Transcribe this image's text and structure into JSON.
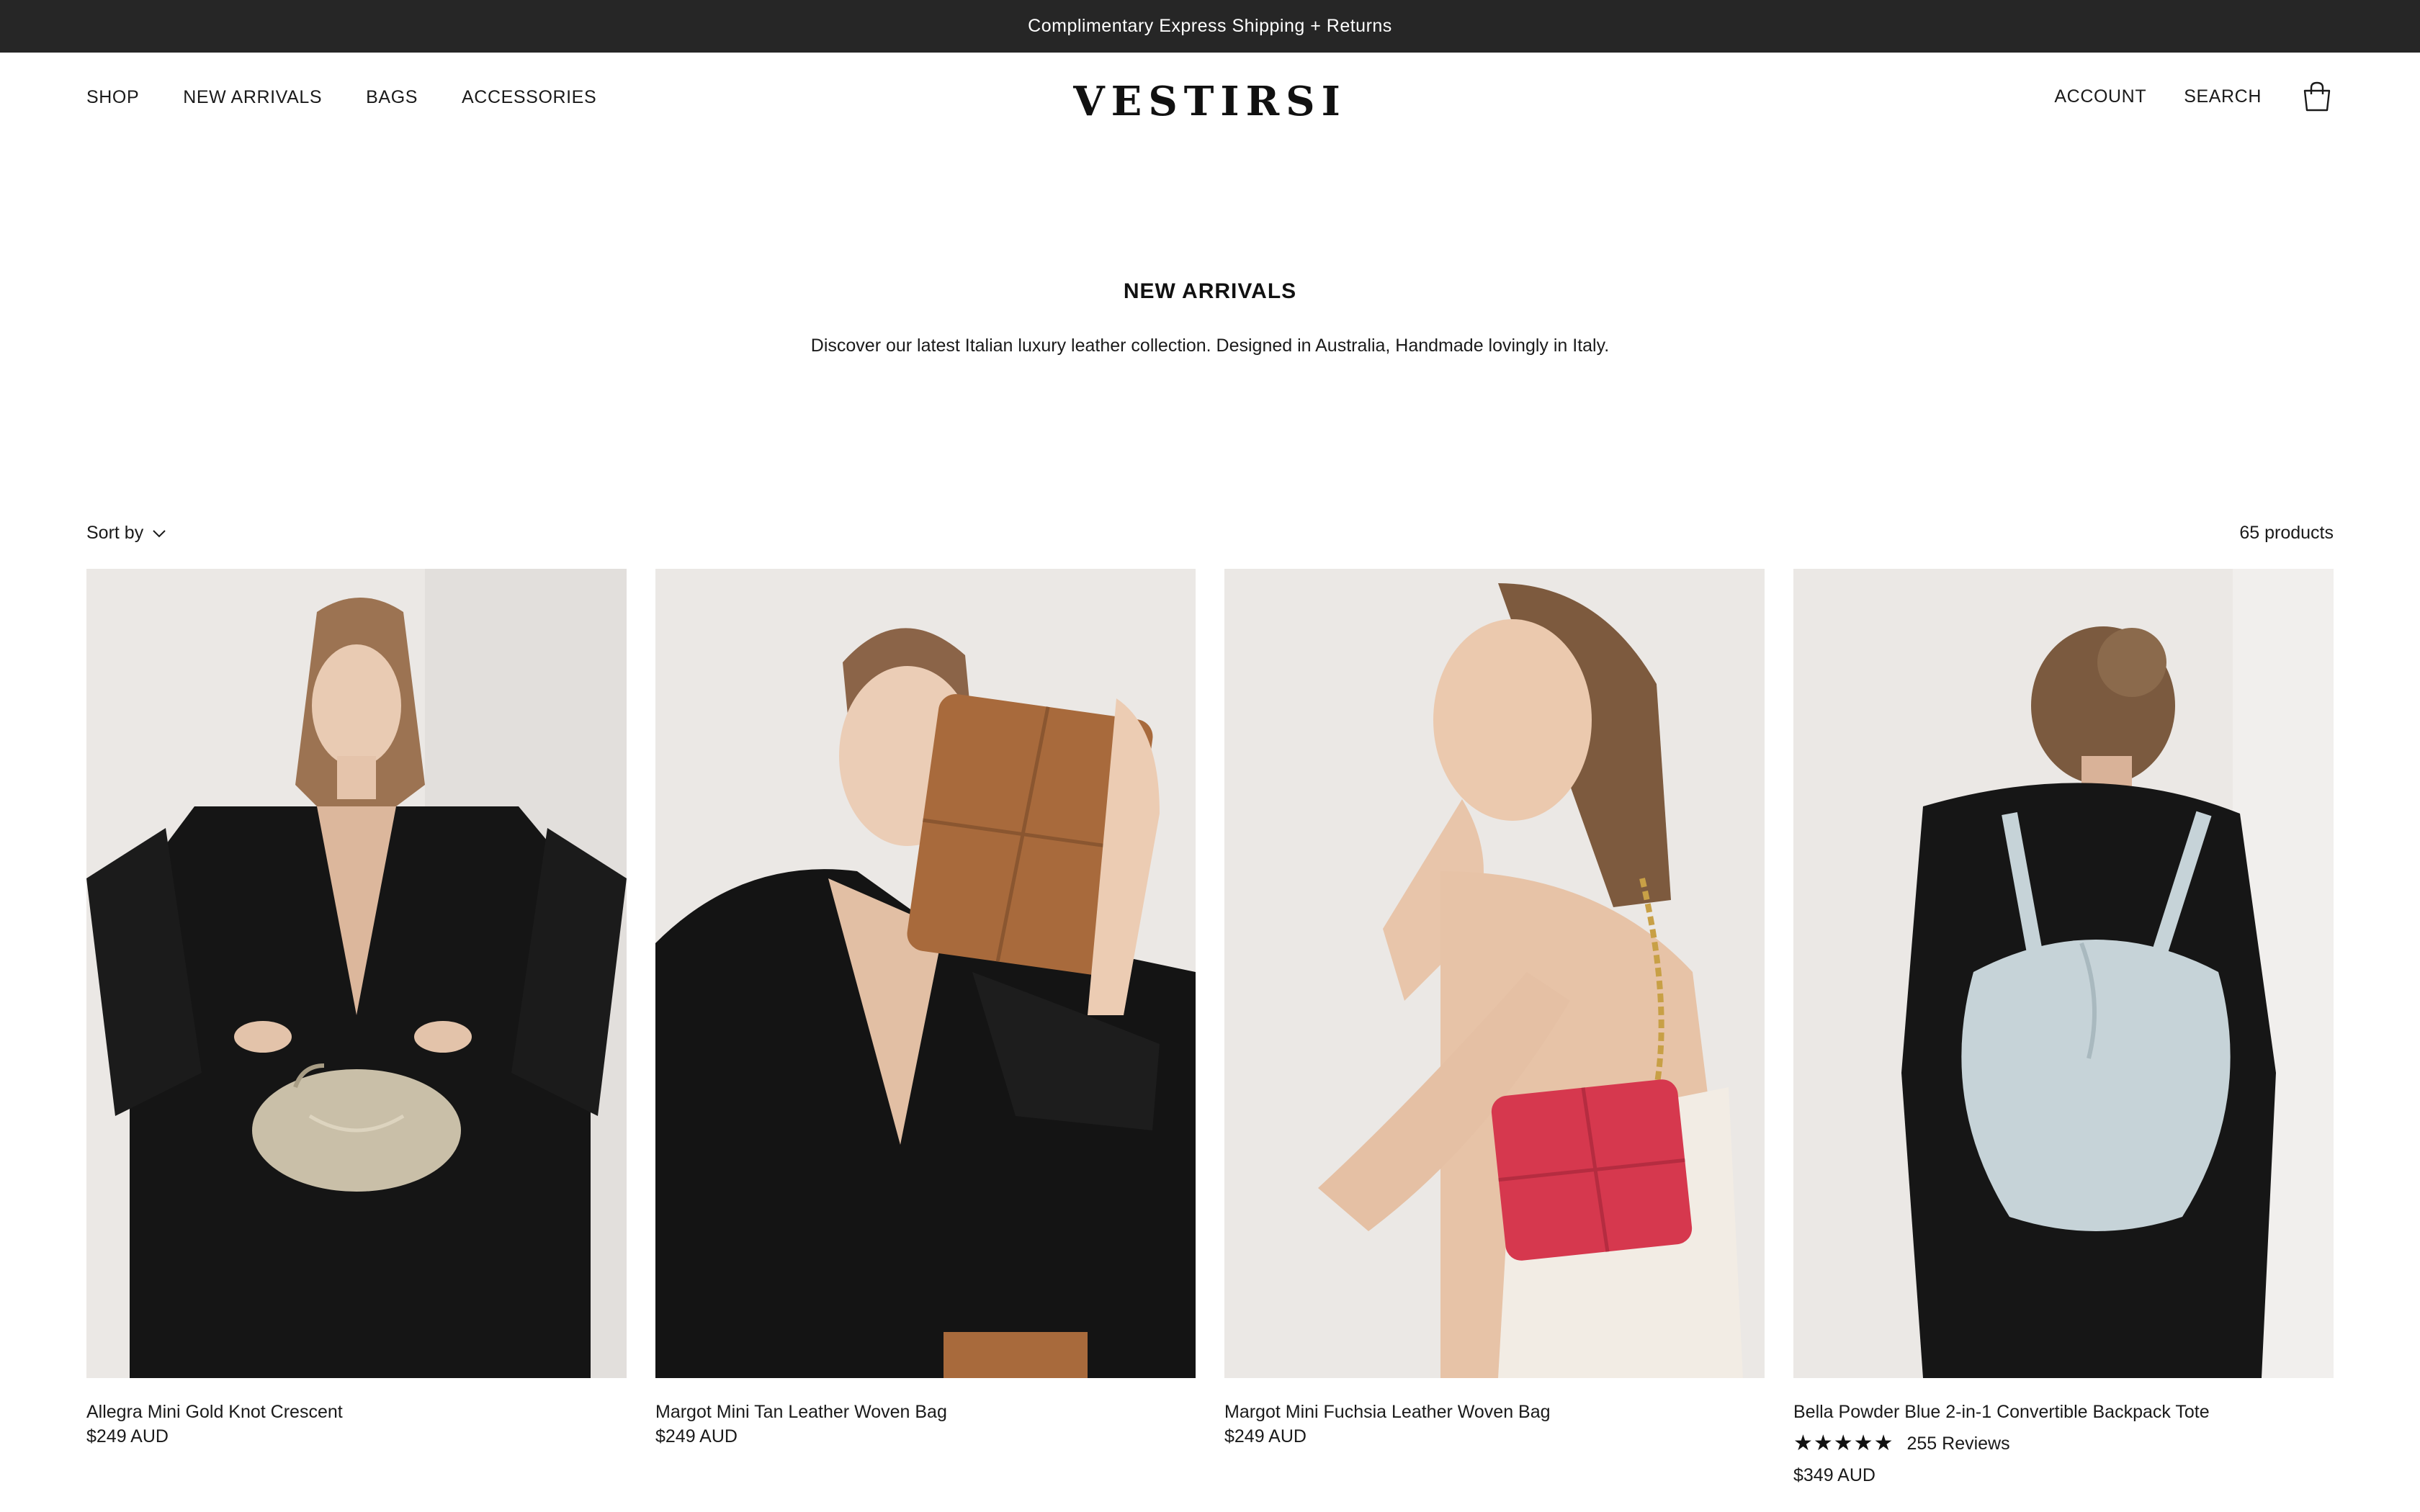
{
  "announcement": "Complimentary Express Shipping + Returns",
  "brand": "VESTIRSI",
  "nav_left": [
    "SHOP",
    "NEW ARRIVALS",
    "BAGS",
    "ACCESSORIES"
  ],
  "nav_right": {
    "account": "ACCOUNT",
    "search": "SEARCH",
    "cart_icon": "shopping-bag-icon"
  },
  "hero": {
    "title": "NEW ARRIVALS",
    "subtitle": "Discover our latest Italian luxury leather collection. Designed in Australia, Handmade lovingly in Italy."
  },
  "toolbar": {
    "sort_label": "Sort by",
    "sort_icon": "chevron-down-icon",
    "count": "65 products"
  },
  "products": [
    {
      "title": "Allegra Mini Gold Knot Crescent",
      "price": "$249 AUD",
      "bag_color": "#c9bfa8"
    },
    {
      "title": "Margot Mini Tan Leather Woven Bag",
      "price": "$249 AUD",
      "bag_color": "#a86a3c"
    },
    {
      "title": "Margot Mini Fuchsia Leather Woven Bag",
      "price": "$249 AUD",
      "bag_color": "#d6384e"
    },
    {
      "title": "Bella Powder Blue 2-in-1 Convertible Backpack Tote",
      "price": "$349 AUD",
      "bag_color": "#c6d3d8",
      "stars": "★★★★★",
      "rating": 5,
      "reviews": "255 Reviews"
    }
  ],
  "colors": {
    "announcement_bg": "#262626",
    "text": "#1a1a1a",
    "photo_bg": "#ebe8e5"
  }
}
